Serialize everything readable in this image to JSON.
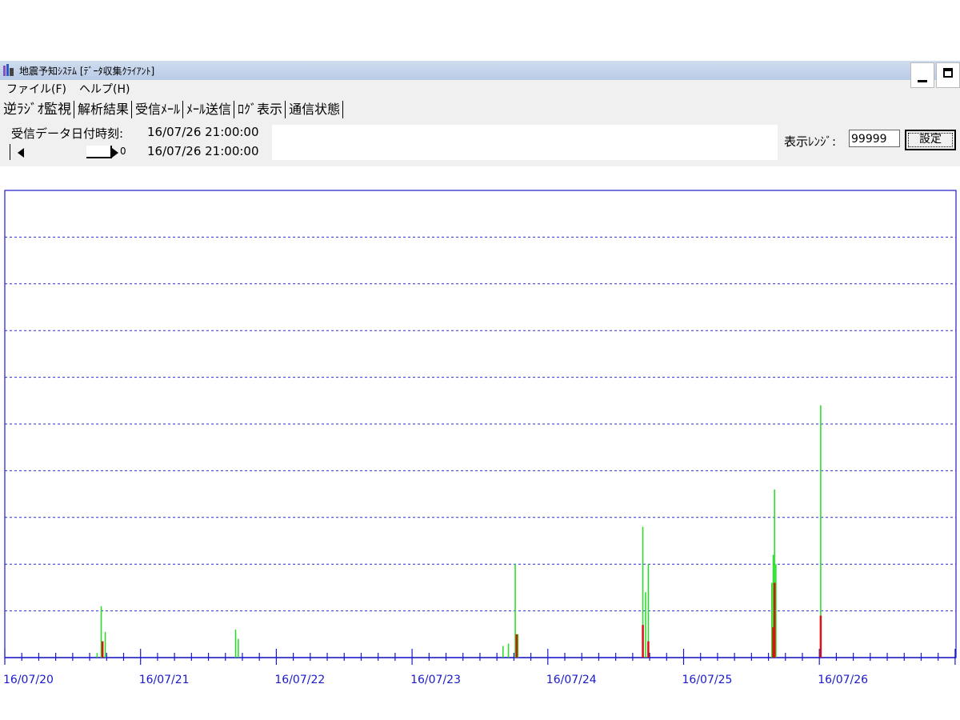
{
  "window": {
    "title": "地震予知ｼｽﾃﾑ [ﾃﾞｰﾀ収集ｸﾗｲｱﾝﾄ]"
  },
  "menu": [
    {
      "label": "ファイル(F)"
    },
    {
      "label": "ヘルプ(H)"
    }
  ],
  "tabs": [
    {
      "label": "逆ﾗｼﾞｵ監視",
      "active": true
    },
    {
      "label": "解析結果",
      "active": false
    },
    {
      "label": "受信ﾒｰﾙ",
      "active": false
    },
    {
      "label": "ﾒｰﾙ送信",
      "active": false
    },
    {
      "label": "ﾛｸﾞ表示",
      "active": false
    },
    {
      "label": "通信状態",
      "active": false
    }
  ],
  "info": {
    "recv_label": "受信データ日付時刻:",
    "recv_datetime": "16/07/26 21:00:00",
    "slider_value": "0",
    "slider_datetime": "16/07/26 21:00:00"
  },
  "range": {
    "label": "表示ﾚﾝｼﾞ:",
    "value": "99999",
    "button": "設定"
  },
  "colors": {
    "axis": "#1a1ac9",
    "grid": "#2b2bd6",
    "series_green": "#22dd22",
    "series_red": "#dd1111"
  },
  "chart_data": {
    "type": "bar",
    "x_labels": [
      "16/07/20",
      "16/07/21",
      "16/07/22",
      "16/07/23",
      "16/07/24",
      "16/07/25",
      "16/07/26"
    ],
    "ylim": [
      0,
      10
    ],
    "grid": "dashed-horizontal",
    "series": [
      {
        "color": "green",
        "points": [
          {
            "x": 0.71,
            "y": 1.1
          },
          {
            "x": 0.74,
            "y": 0.55
          },
          {
            "x": 0.68,
            "y": 0.1
          },
          {
            "x": 1.7,
            "y": 0.6
          },
          {
            "x": 1.72,
            "y": 0.4
          },
          {
            "x": 3.67,
            "y": 0.25
          },
          {
            "x": 3.71,
            "y": 0.3
          },
          {
            "x": 3.76,
            "y": 2.0
          },
          {
            "x": 3.78,
            "y": 0.5
          },
          {
            "x": 4.7,
            "y": 2.8
          },
          {
            "x": 4.72,
            "y": 1.4
          },
          {
            "x": 4.74,
            "y": 2.0
          },
          {
            "x": 5.65,
            "y": 1.6
          },
          {
            "x": 5.66,
            "y": 2.2
          },
          {
            "x": 5.67,
            "y": 3.6
          },
          {
            "x": 5.68,
            "y": 2.0
          },
          {
            "x": 6.01,
            "y": 5.4
          }
        ]
      },
      {
        "color": "red",
        "points": [
          {
            "x": 0.72,
            "y": 0.35
          },
          {
            "x": 3.77,
            "y": 0.5
          },
          {
            "x": 4.7,
            "y": 0.7
          },
          {
            "x": 4.74,
            "y": 0.35
          },
          {
            "x": 5.66,
            "y": 0.65
          },
          {
            "x": 5.67,
            "y": 1.6
          },
          {
            "x": 6.01,
            "y": 0.9
          }
        ]
      }
    ]
  }
}
